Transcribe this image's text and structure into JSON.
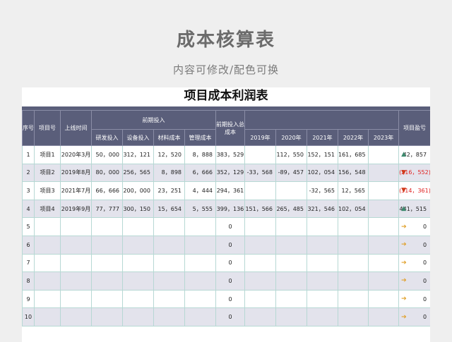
{
  "header": {
    "title": "成本核算表",
    "subtitle": "内容可修改/配色可换"
  },
  "sheet": {
    "title": "项目成本利润表",
    "headers": {
      "index": "序号",
      "project": "项目号",
      "launch": "上线时间",
      "pre_investment": "前期投入",
      "rd": "研发投入",
      "equipment": "设备投入",
      "material": "材料成本",
      "management": "管理成本",
      "total_cost": "前期投入总成本",
      "y2019": "2019年",
      "y2020": "2020年",
      "y2021": "2021年",
      "y2022": "2022年",
      "y2023": "2023年",
      "profit": "项目盈亏"
    },
    "rows": [
      {
        "idx": "1",
        "project": "项目1",
        "launch": "2020年3月",
        "rd": "50，000",
        "equip": "312，121",
        "material": "12，520",
        "mgmt": "8，888",
        "total": "383，529",
        "y2019": "",
        "y2020": "112，550",
        "y2021": "152，151",
        "y2022": "161，685",
        "y2023": "",
        "trend": "up",
        "profit": "42，857"
      },
      {
        "idx": "2",
        "project": "项目2",
        "launch": "2019年8月",
        "rd": "80，000",
        "equip": "256，565",
        "material": "8，898",
        "mgmt": "6，666",
        "total": "352，129",
        "y2019": "-33，568",
        "y2020": "-89，457",
        "y2021": "102，054",
        "y2022": "156，548",
        "y2023": "",
        "trend": "down",
        "profit": "(216，552)"
      },
      {
        "idx": "3",
        "project": "项目3",
        "launch": "2021年7月",
        "rd": "66，666",
        "equip": "200，000",
        "material": "23，251",
        "mgmt": "4，444",
        "total": "294，361",
        "y2019": "",
        "y2020": "",
        "y2021": "-32，565",
        "y2022": "12，565",
        "y2023": "",
        "trend": "down",
        "profit": "(314，361)"
      },
      {
        "idx": "4",
        "project": "项目4",
        "launch": "2019年9月",
        "rd": "77，777",
        "equip": "300，150",
        "material": "15，654",
        "mgmt": "5，555",
        "total": "399，136",
        "y2019": "151，566",
        "y2020": "265，485",
        "y2021": "321，546",
        "y2022": "102，054",
        "y2023": "",
        "trend": "up",
        "profit": "441，515"
      },
      {
        "idx": "5",
        "project": "",
        "launch": "",
        "rd": "",
        "equip": "",
        "material": "",
        "mgmt": "",
        "total": "0",
        "y2019": "",
        "y2020": "",
        "y2021": "",
        "y2022": "",
        "y2023": "",
        "trend": "flat",
        "profit": "0"
      },
      {
        "idx": "6",
        "project": "",
        "launch": "",
        "rd": "",
        "equip": "",
        "material": "",
        "mgmt": "",
        "total": "0",
        "y2019": "",
        "y2020": "",
        "y2021": "",
        "y2022": "",
        "y2023": "",
        "trend": "flat",
        "profit": "0"
      },
      {
        "idx": "7",
        "project": "",
        "launch": "",
        "rd": "",
        "equip": "",
        "material": "",
        "mgmt": "",
        "total": "0",
        "y2019": "",
        "y2020": "",
        "y2021": "",
        "y2022": "",
        "y2023": "",
        "trend": "flat",
        "profit": "0"
      },
      {
        "idx": "8",
        "project": "",
        "launch": "",
        "rd": "",
        "equip": "",
        "material": "",
        "mgmt": "",
        "total": "0",
        "y2019": "",
        "y2020": "",
        "y2021": "",
        "y2022": "",
        "y2023": "",
        "trend": "flat",
        "profit": "0"
      },
      {
        "idx": "9",
        "project": "",
        "launch": "",
        "rd": "",
        "equip": "",
        "material": "",
        "mgmt": "",
        "total": "0",
        "y2019": "",
        "y2020": "",
        "y2021": "",
        "y2022": "",
        "y2023": "",
        "trend": "flat",
        "profit": "0"
      },
      {
        "idx": "10",
        "project": "",
        "launch": "",
        "rd": "",
        "equip": "",
        "material": "",
        "mgmt": "",
        "total": "0",
        "y2019": "",
        "y2020": "",
        "y2021": "",
        "y2022": "",
        "y2023": "",
        "trend": "flat",
        "profit": "0"
      }
    ],
    "trend_icons": {
      "up": "arrow-up-icon",
      "down": "arrow-down-icon",
      "flat": "arrow-right-icon"
    },
    "colors": {
      "header_bg": "#5a5e7a",
      "negative": "#e02020",
      "up": "#3d8a6e",
      "down": "#d03a1a",
      "flat": "#e0a02a"
    }
  }
}
